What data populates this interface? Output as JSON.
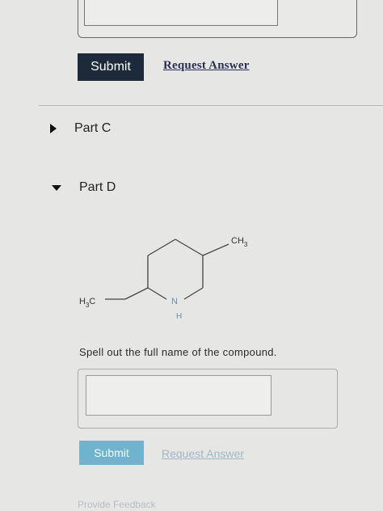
{
  "previous_part": {
    "submit_label": "Submit",
    "request_answer_label": "Request Answer"
  },
  "part_c": {
    "label": "Part C",
    "state": "collapsed"
  },
  "part_d": {
    "label": "Part D",
    "state": "expanded",
    "structure": {
      "substituent_right": "CH",
      "substituent_right_sub": "3",
      "substituent_left_a": "H",
      "substituent_left_sub": "3",
      "substituent_left_b": "C",
      "ring_atom": "N",
      "ring_atom_h": "H"
    },
    "prompt": "Spell out the full name of the compound.",
    "answer_value": "",
    "submit_label": "Submit",
    "request_answer_label": "Request Answer"
  },
  "footer": {
    "link_label": "Provide Feedback"
  }
}
